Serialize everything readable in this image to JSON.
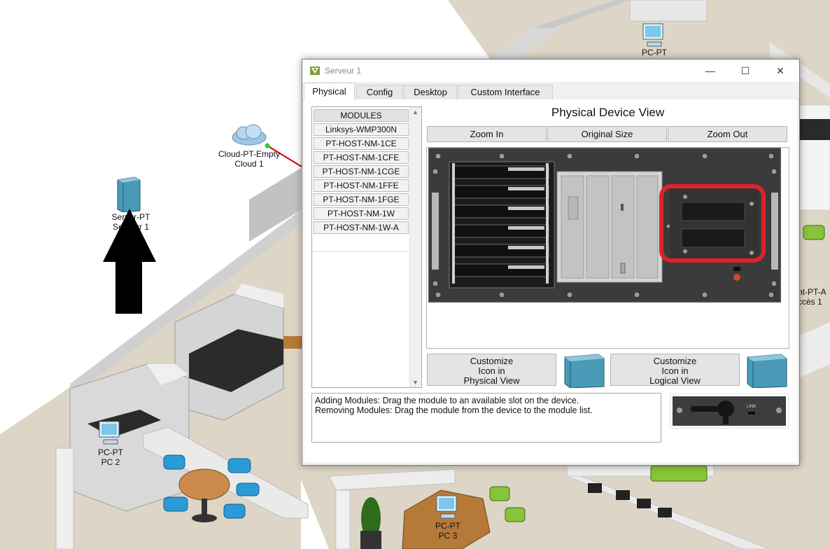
{
  "workspace": {
    "devices": [
      {
        "name": "PC-PT",
        "label2": ""
      },
      {
        "name": "Cloud-PT-Empty",
        "label2": "Cloud 1"
      },
      {
        "name": "Server-PT",
        "label2": "Serveur 1"
      },
      {
        "name": "PC-PT",
        "label2": "PC 2"
      },
      {
        "name": "PC-PT",
        "label2": "PC 3"
      },
      {
        "name": "nt-PT-A",
        "label2": "ccès 1"
      }
    ]
  },
  "window": {
    "title": "Serveur 1",
    "controls": {
      "minimize": "—",
      "maximize": "☐",
      "close": "✕"
    },
    "tabs": [
      "Physical",
      "Config",
      "Desktop",
      "Custom Interface"
    ],
    "active_tab": "Physical"
  },
  "modules": {
    "header": "MODULES",
    "items": [
      "Linksys-WMP300N",
      "PT-HOST-NM-1CE",
      "PT-HOST-NM-1CFE",
      "PT-HOST-NM-1CGE",
      "PT-HOST-NM-1FFE",
      "PT-HOST-NM-1FGE",
      "PT-HOST-NM-1W",
      "PT-HOST-NM-1W-A"
    ]
  },
  "physical_view": {
    "title": "Physical Device View",
    "zoom_in": "Zoom In",
    "original_size": "Original Size",
    "zoom_out": "Zoom Out"
  },
  "customize": {
    "physical": {
      "line1": "Customize",
      "line2": "Icon in",
      "line3": "Physical View"
    },
    "logical": {
      "line1": "Customize",
      "line2": "Icon in",
      "line3": "Logical View"
    }
  },
  "info": {
    "line1": "Adding Modules: Drag the module to an available slot on the device.",
    "line2": "Removing Modules: Drag the module from the device to the module list."
  },
  "preview": {
    "link_label": "LINK"
  },
  "colors": {
    "highlight": "#e0222a",
    "server_blue": "#4a9ab8",
    "link_dot": "#33cc33"
  },
  "icons": {
    "arrow": "up-arrow-icon",
    "app": "packet-tracer-icon",
    "cloud": "cloud-icon",
    "server": "server-icon",
    "pc": "pc-icon"
  }
}
